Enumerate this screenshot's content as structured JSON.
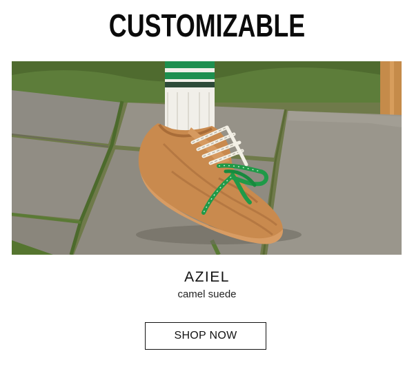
{
  "headline": "CUSTOMIZABLE",
  "product": {
    "name": "AZIEL",
    "variant": "camel suede"
  },
  "cta": {
    "label": "SHOP NOW"
  },
  "colors": {
    "shoe": "#c98a4e",
    "lace_green": "#1f9a48",
    "sock_stripe_green": "#1e8f4f",
    "background": "#ffffff",
    "text": "#111111"
  }
}
